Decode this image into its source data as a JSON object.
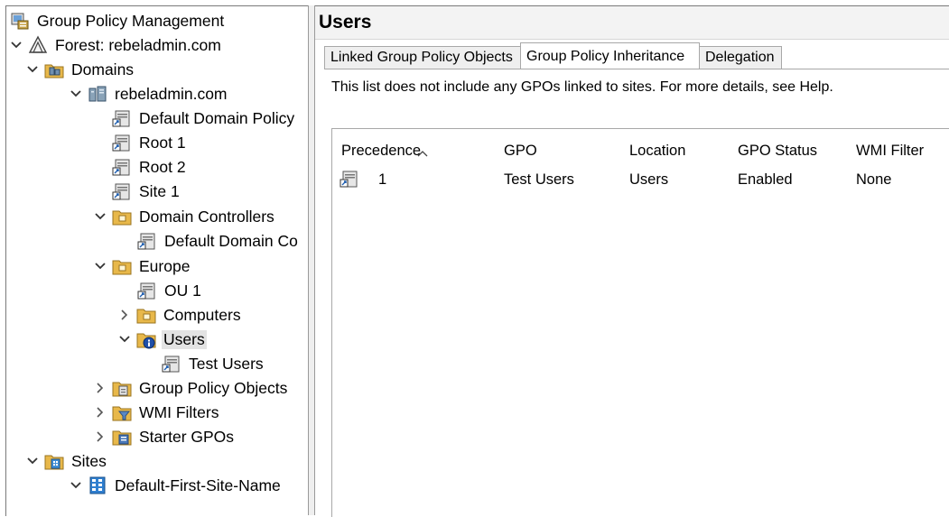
{
  "tree": {
    "items": [
      {
        "label": "Group Policy Management",
        "icon": "gpm-console-icon",
        "expander": "none"
      },
      {
        "label": "Forest: rebeladmin.com",
        "icon": "forest-icon",
        "expander": "expanded"
      },
      {
        "label": "Domains",
        "icon": "domains-folder-icon",
        "expander": "expanded"
      },
      {
        "label": "rebeladmin.com",
        "icon": "domain-icon",
        "expander": "expanded"
      },
      {
        "label": "Default Domain Policy",
        "icon": "gpo-link-icon",
        "expander": "none"
      },
      {
        "label": "Root 1",
        "icon": "gpo-link-icon",
        "expander": "none"
      },
      {
        "label": "Root 2",
        "icon": "gpo-link-icon",
        "expander": "none"
      },
      {
        "label": "Site 1",
        "icon": "gpo-link-icon",
        "expander": "none"
      },
      {
        "label": "Domain Controllers",
        "icon": "ou-folder-icon",
        "expander": "expanded"
      },
      {
        "label": "Default Domain Co",
        "icon": "gpo-link-icon",
        "expander": "none"
      },
      {
        "label": "Europe",
        "icon": "ou-folder-icon",
        "expander": "expanded"
      },
      {
        "label": "OU 1",
        "icon": "gpo-link-icon",
        "expander": "none"
      },
      {
        "label": "Computers",
        "icon": "ou-folder-icon",
        "expander": "collapsed"
      },
      {
        "label": "Users",
        "icon": "blocked-ou-folder-icon",
        "expander": "expanded",
        "selected": true
      },
      {
        "label": "Test Users",
        "icon": "gpo-link-icon",
        "expander": "none"
      },
      {
        "label": "Group Policy Objects",
        "icon": "gpo-container-icon",
        "expander": "collapsed"
      },
      {
        "label": "WMI Filters",
        "icon": "wmi-filters-icon",
        "expander": "collapsed"
      },
      {
        "label": "Starter GPOs",
        "icon": "starter-gpos-icon",
        "expander": "collapsed"
      },
      {
        "label": "Sites",
        "icon": "sites-folder-icon",
        "expander": "expanded"
      },
      {
        "label": "Default-First-Site-Name",
        "icon": "site-icon",
        "expander": "expanded"
      }
    ]
  },
  "details": {
    "title": "Users",
    "tabs": [
      {
        "label": "Linked Group Policy Objects"
      },
      {
        "label": "Group Policy Inheritance",
        "active": true
      },
      {
        "label": "Delegation"
      }
    ],
    "info_text": "This list does not include any GPOs linked to sites. For more details, see Help.",
    "columns": [
      "Precedence",
      "GPO",
      "Location",
      "GPO Status",
      "WMI Filter"
    ],
    "rows": [
      {
        "precedence": "1",
        "gpo": "Test Users",
        "location": "Users",
        "status": "Enabled",
        "wmi_filter": "None"
      }
    ]
  },
  "colors": {
    "folder": "#e8b84a",
    "selection": "#e3e3e3",
    "border": "#a8a8a8"
  }
}
